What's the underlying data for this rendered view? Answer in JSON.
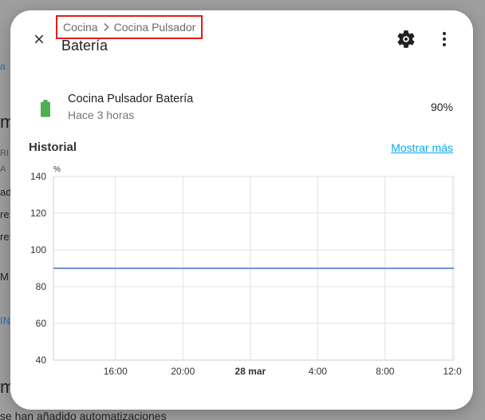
{
  "background": {
    "fragments": [
      "a",
      "m",
      "RI S",
      "A",
      "ado",
      "re:",
      "re:",
      "M",
      "IN",
      "m",
      "se han añadido automatizaciones"
    ]
  },
  "dialog": {
    "breadcrumb": [
      "Cocina",
      "Cocina Pulsador"
    ],
    "title": "Batería",
    "icons": {
      "close": "close-icon",
      "settings": "gear-icon",
      "more": "more-vert-icon",
      "battery": "battery-full-icon"
    },
    "entity": {
      "name": "Cocina Pulsador Batería",
      "last_changed": "Hace 3 horas",
      "value": "90%"
    },
    "history": {
      "title": "Historial",
      "show_more": "Mostrar más"
    }
  },
  "colors": {
    "battery": "#4caf50",
    "line": "#4a6fd1",
    "link": "#03a9f4",
    "breadcrumb_highlight": "#e11d1d"
  },
  "chart_data": {
    "type": "line",
    "y_unit": "%",
    "ylim": [
      40,
      140
    ],
    "y_ticks": [
      140,
      120,
      100,
      80,
      60,
      40
    ],
    "x_ticks": [
      "16:00",
      "20:00",
      "28 mar",
      "4:00",
      "8:00",
      "12:0"
    ],
    "x_tick_bold": [
      false,
      false,
      true,
      false,
      false,
      false
    ],
    "series": [
      {
        "values": [
          90,
          90
        ]
      }
    ],
    "grid": true
  }
}
